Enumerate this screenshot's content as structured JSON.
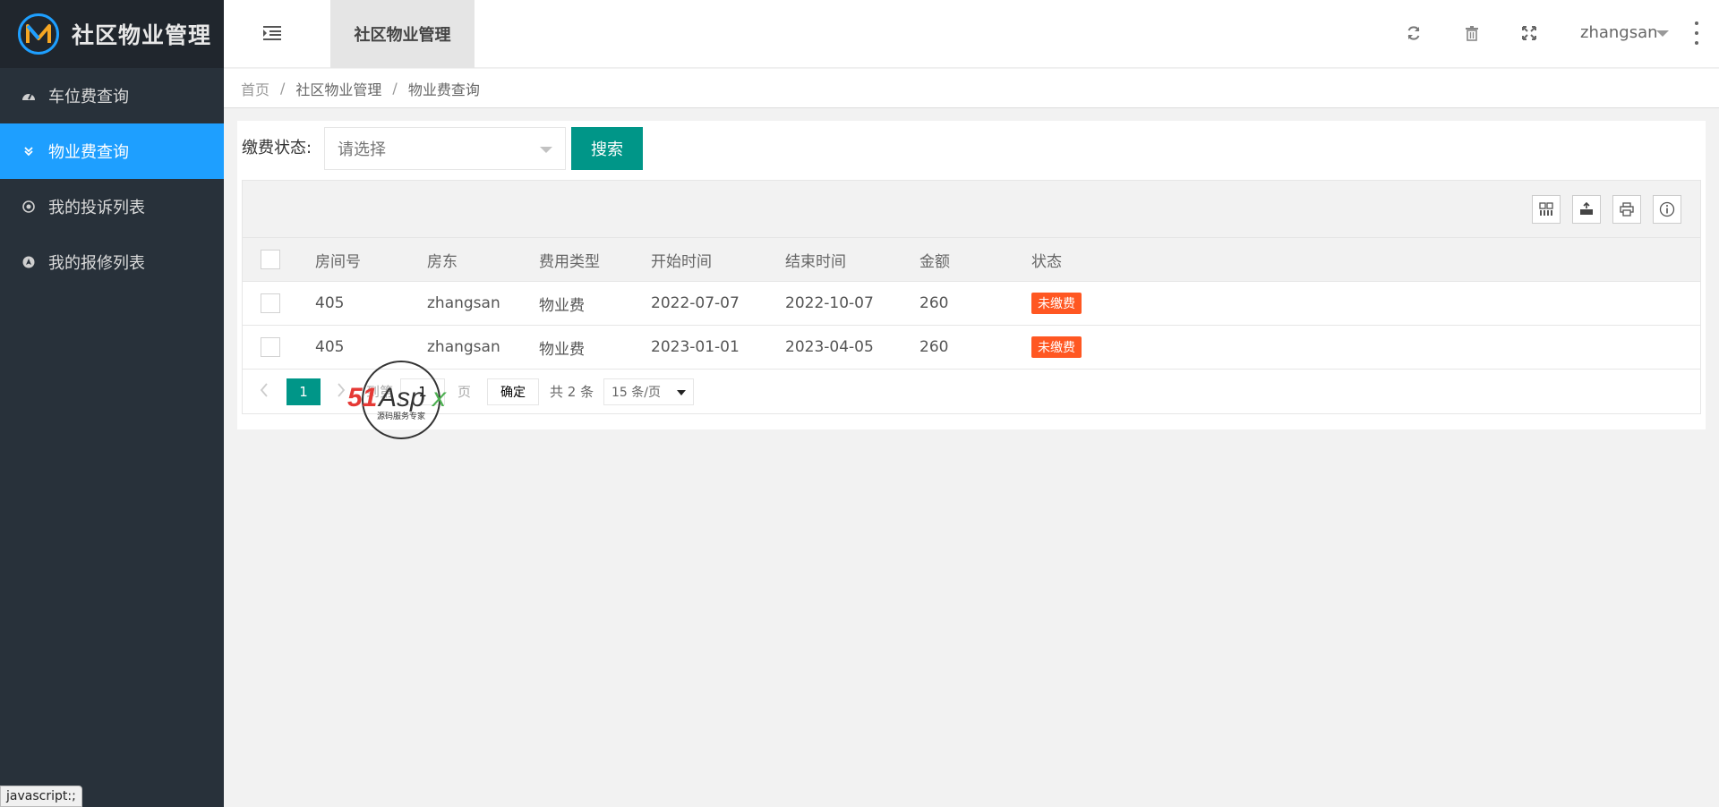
{
  "app": {
    "title": "社区物业管理"
  },
  "sidebar": {
    "items": [
      {
        "label": "车位费查询",
        "icon": "dashboard-icon"
      },
      {
        "label": "物业费查询",
        "icon": "double-chevron-icon",
        "active": true
      },
      {
        "label": "我的投诉列表",
        "icon": "target-icon"
      },
      {
        "label": "我的报修列表",
        "icon": "navigation-icon"
      }
    ],
    "status_tip": "javascript:;"
  },
  "header": {
    "tab_label": "社区物业管理",
    "user": "zhangsan",
    "icons": [
      "refresh-icon",
      "trash-icon",
      "fullscreen-icon",
      "more-icon"
    ]
  },
  "breadcrumb": [
    "首页",
    "社区物业管理",
    "物业费查询"
  ],
  "filter": {
    "label": "缴费状态:",
    "placeholder": "请选择",
    "search_label": "搜索"
  },
  "table": {
    "toolbar_icons": [
      "columns-icon",
      "export-icon",
      "print-icon",
      "info-icon"
    ],
    "columns": [
      "房间号",
      "房东",
      "费用类型",
      "开始时间",
      "结束时间",
      "金额",
      "状态"
    ],
    "rows": [
      [
        "405",
        "zhangsan",
        "物业费",
        "2022-07-07",
        "2022-10-07",
        "260",
        "未缴费"
      ],
      [
        "405",
        "zhangsan",
        "物业费",
        "2023-01-01",
        "2023-04-05",
        "260",
        "未缴费"
      ]
    ],
    "status_color": "#ff5722"
  },
  "pager": {
    "current": "1",
    "goto_label": "到第",
    "goto_value": "1",
    "page_label": "页",
    "confirm_label": "确定",
    "total_label": "共 2 条",
    "limit_label": "15 条/页"
  },
  "watermark": {
    "brand": "51Aspx",
    "tagline": "源码服务专家"
  },
  "colors": {
    "accent": "#1e9fff",
    "primary": "#009688",
    "sidebar": "#28313a"
  }
}
